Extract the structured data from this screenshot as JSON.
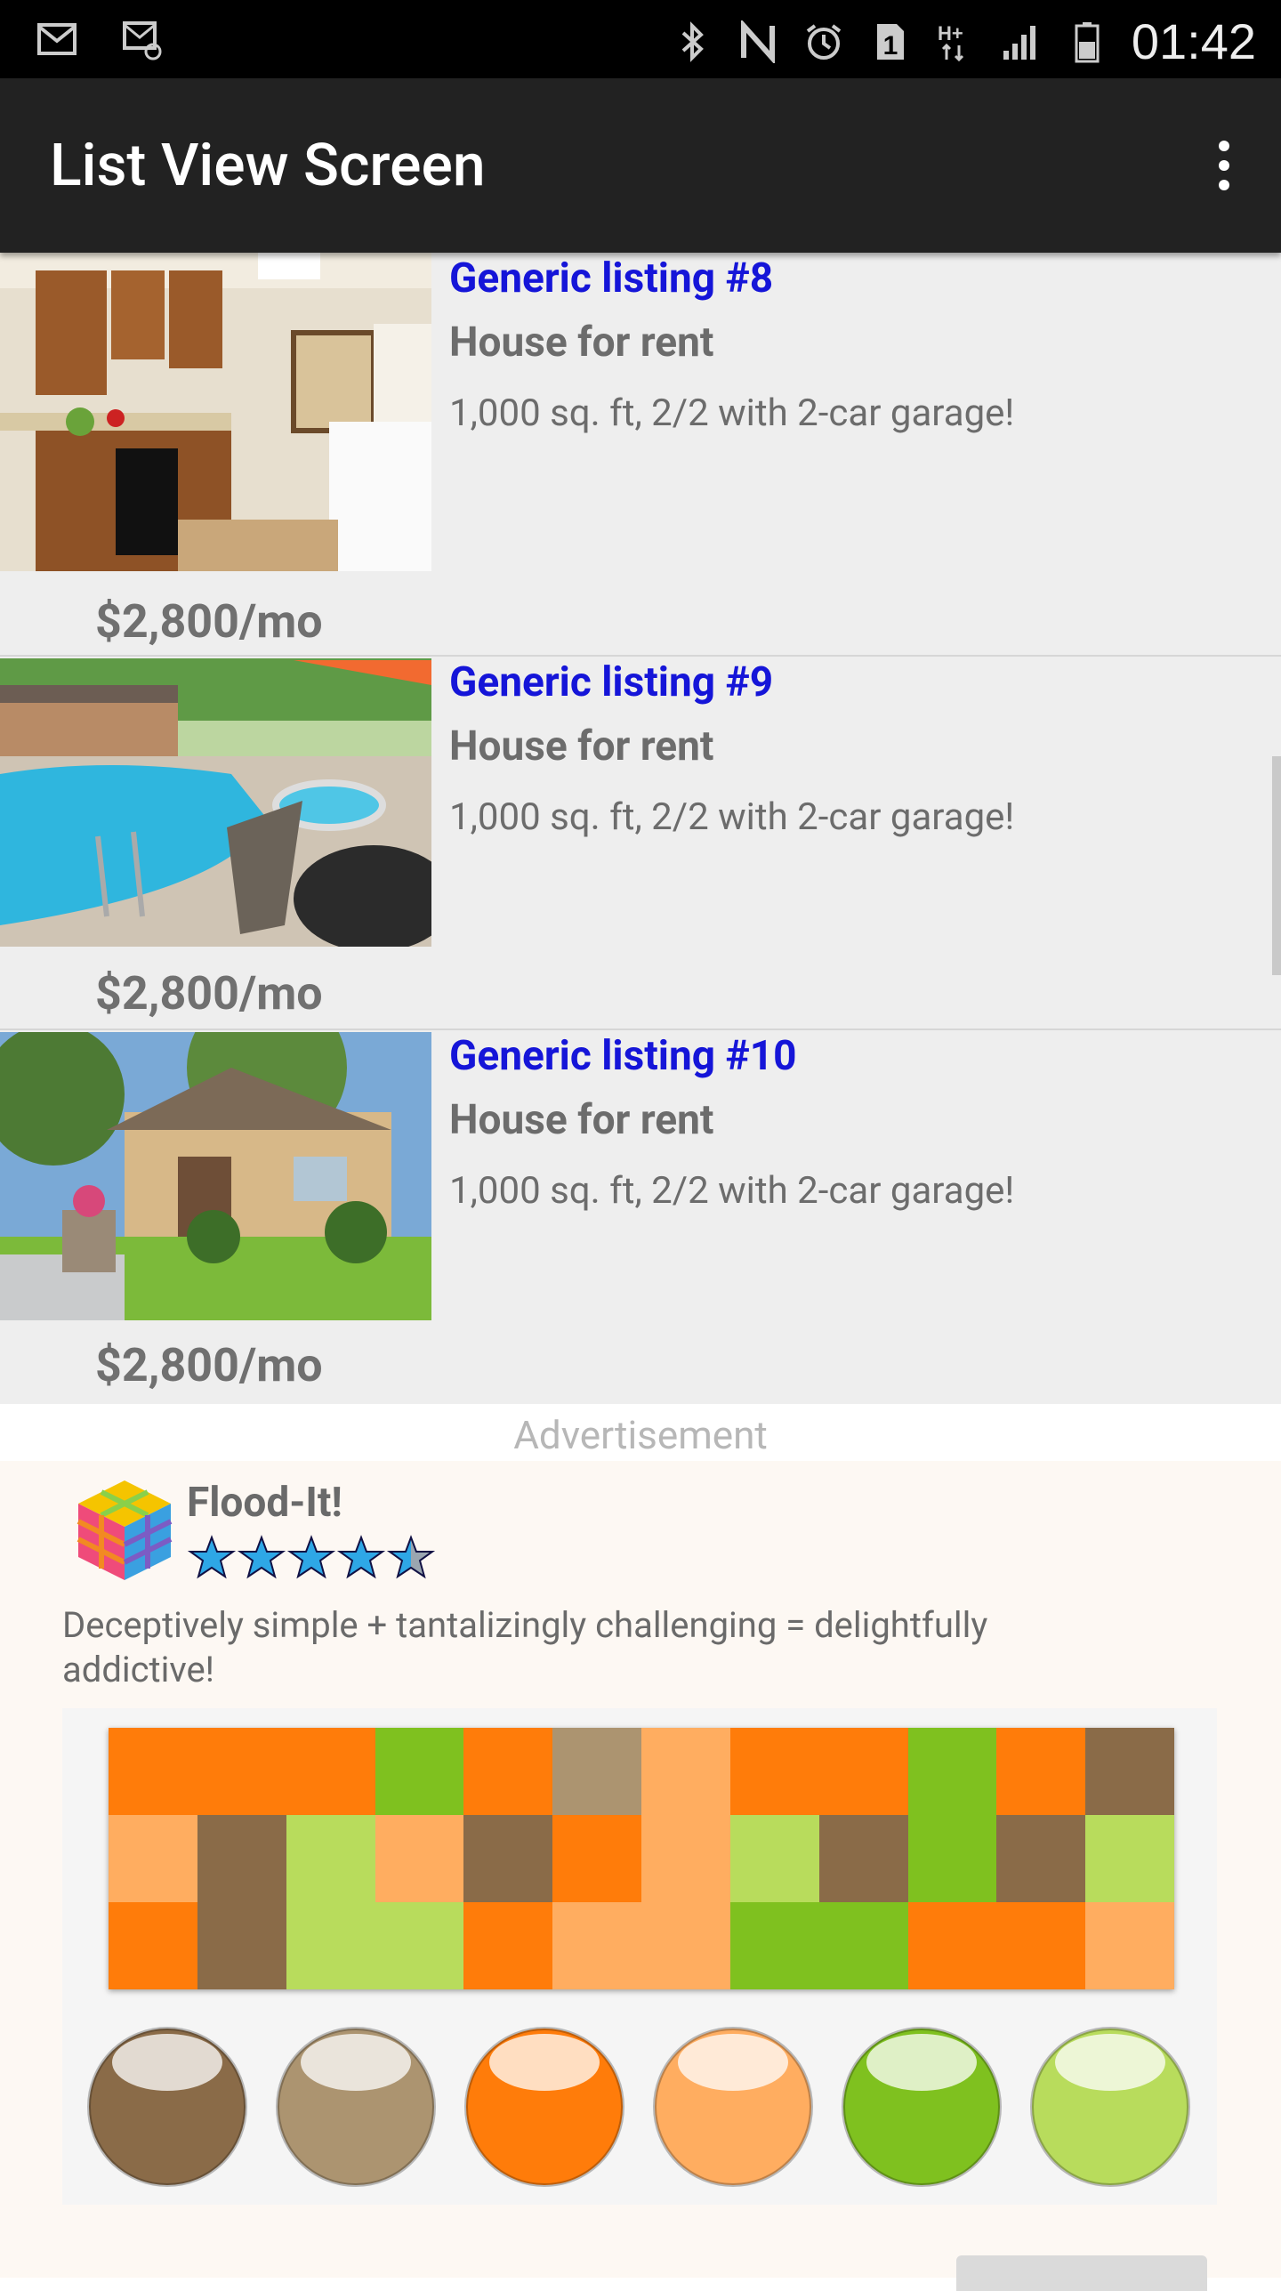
{
  "status_bar": {
    "time": "01:42",
    "left_icons": [
      "gmail-icon",
      "email-icon"
    ],
    "right_icons": [
      "bluetooth-icon",
      "nfc-icon",
      "alarm-icon",
      "sim-1-icon",
      "hplus-data-icon",
      "signal-icon",
      "battery-icon"
    ]
  },
  "app_bar": {
    "title": "List View Screen",
    "overflow_icon": "more-vert-icon"
  },
  "listings": [
    {
      "title": "Generic listing #8",
      "type": "House for rent",
      "details": "1,000 sq. ft, 2/2 with 2-car garage!",
      "price": "$2,800/mo",
      "image": "kitchen-photo"
    },
    {
      "title": "Generic listing #9",
      "type": "House for rent",
      "details": "1,000 sq. ft, 2/2 with 2-car garage!",
      "price": "$2,800/mo",
      "image": "pool-photo"
    },
    {
      "title": "Generic listing #10",
      "type": "House for rent",
      "details": "1,000 sq. ft, 2/2 with 2-car garage!",
      "price": "$2,800/mo",
      "image": "house-exterior-photo"
    }
  ],
  "ad": {
    "label": "Advertisement",
    "app_name": "Flood-It!",
    "rating": 4.5,
    "tagline": "Deceptively simple + tantalizingly challenging = delightfully addictive!",
    "colors": {
      "orange": "#ff7c0a",
      "light_orange": "#ffad60",
      "green": "#7fc11f",
      "light_green": "#b8dc5c",
      "brown": "#8a6b48",
      "tan": "#ac9470"
    },
    "grid": [
      [
        "orange",
        "orange",
        "orange",
        "green",
        "orange",
        "tan",
        "light_orange",
        "orange",
        "orange",
        "green",
        "orange",
        "brown"
      ],
      [
        "light_orange",
        "brown",
        "light_green",
        "light_orange",
        "brown",
        "orange",
        "light_orange",
        "light_green",
        "brown",
        "green",
        "brown",
        "light_green"
      ],
      [
        "orange",
        "brown",
        "light_green",
        "light_green",
        "orange",
        "light_orange",
        "light_orange",
        "green",
        "green",
        "orange",
        "orange",
        "light_orange"
      ]
    ],
    "buttons": [
      "brown",
      "tan",
      "orange",
      "light_orange",
      "green",
      "light_green"
    ]
  }
}
